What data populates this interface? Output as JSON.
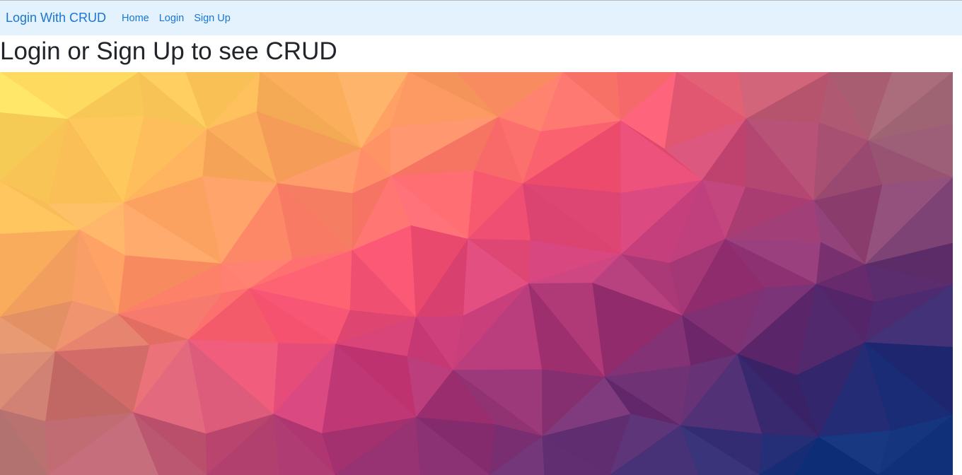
{
  "navbar": {
    "brand": "Login With CRUD",
    "links": [
      {
        "label": "Home"
      },
      {
        "label": "Login"
      },
      {
        "label": "Sign Up"
      }
    ]
  },
  "main": {
    "heading": "Login or Sign Up to see CRUD"
  },
  "hero_image": {
    "description_colors": {
      "yellow": "#ffe05a",
      "orange": "#ffb25e",
      "coral": "#ff7e6c",
      "pink": "#ff4f74",
      "magenta": "#b23c78",
      "purple": "#5a2f74",
      "navy": "#0a2f7e",
      "taupe": "#8a7b6e"
    }
  }
}
